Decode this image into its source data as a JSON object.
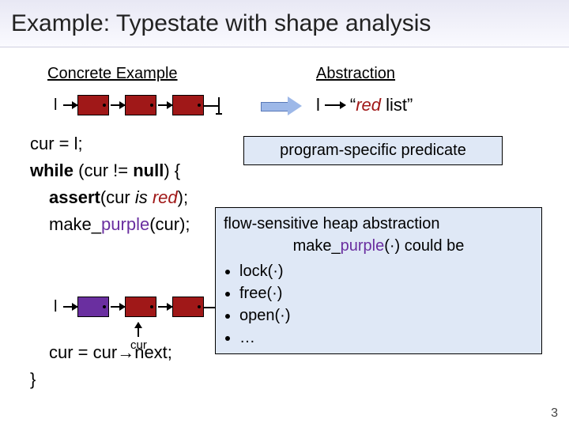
{
  "title": "Example: Typestate with shape analysis",
  "headings": {
    "concrete": "Concrete Example",
    "abstraction": "Abstraction"
  },
  "list_label": "l",
  "abs": {
    "l": "l",
    "open_quote": "“",
    "red": "red",
    "rest": " list”"
  },
  "callouts": {
    "predicate": "program-specific predicate",
    "heap_line": "flow-sensitive heap abstraction",
    "could_be_prefix": "make_",
    "could_be_mid": "purple",
    "could_be_suffix": "(·) could be",
    "items": {
      "lock": "lock(·)",
      "free": "free(·)",
      "open": "open(·)",
      "ellipsis": "…"
    }
  },
  "code": {
    "line1_a": "cur = l;",
    "line2_while": "while",
    "line2_rest": " (cur != ",
    "line2_null": "null",
    "line2_end": ") {",
    "line3_assert": "assert",
    "line3_rest_a": "(cur ",
    "line3_is": "is",
    "line3_sp": " ",
    "line3_red": "red",
    "line3_end": ");",
    "line4_a": "make_",
    "line4_purple": "purple",
    "line4_end": "(cur);",
    "line5_a": "cur = cur",
    "line5_arrow": "→",
    "line5_b": "next;",
    "line6": "}"
  },
  "cur_label": "cur",
  "slide_number": "3"
}
